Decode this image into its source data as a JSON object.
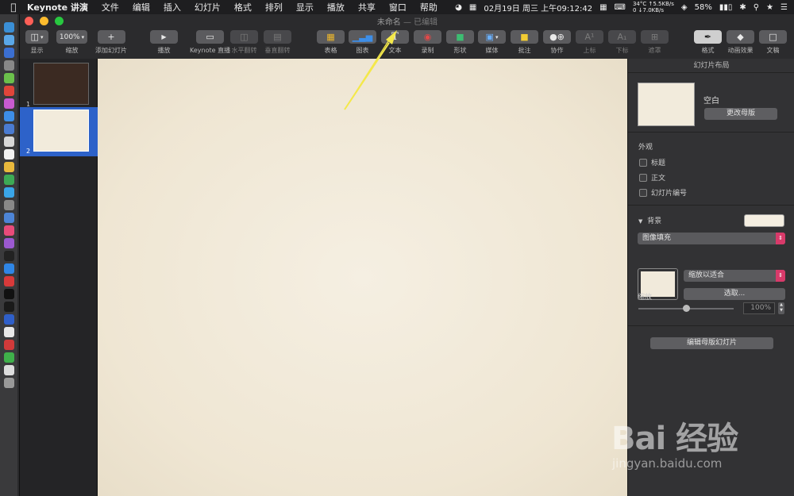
{
  "menubar": {
    "app_name": "Keynote 讲演",
    "items": [
      "文件",
      "编辑",
      "插入",
      "幻灯片",
      "格式",
      "排列",
      "显示",
      "播放",
      "共享",
      "窗口",
      "帮助"
    ],
    "datetime": "02月19日 周三 上午09:12:42",
    "temperature": "34°C",
    "net_up": "↑5.5KB/s",
    "net_down": "↓7.0KB/s",
    "net_count": "0",
    "battery": "58%"
  },
  "window": {
    "title": "未命名",
    "title_suffix": "— 已编辑"
  },
  "toolbar": {
    "view_label": "显示",
    "zoom_value": "100%",
    "zoom_label": "缩放",
    "add_slide_label": "添加幻灯片",
    "play_label": "播放",
    "keynote_live_label": "Keynote 直播",
    "flip_h_label": "水平翻转",
    "flip_v_label": "垂直翻转",
    "table_label": "表格",
    "chart_label": "图表",
    "text_label": "文本",
    "record_label": "录制",
    "shape_label": "形状",
    "media_label": "媒体",
    "comment_label": "批注",
    "collab_label": "协作",
    "superscript_label": "上标",
    "subscript_label": "下标",
    "mask_label": "遮罩",
    "format_label": "格式",
    "animate_label": "动画效果",
    "document_label": "文稿"
  },
  "navigator": {
    "slides": [
      {
        "number": "1",
        "thumb_color": "#3b2a22"
      },
      {
        "number": "2",
        "thumb_color": "#f2ebdc"
      }
    ]
  },
  "inspector": {
    "title": "幻灯片布局",
    "master_name": "空白",
    "change_master_label": "更改母版",
    "appearance_label": "外观",
    "checkbox_title": "标题",
    "checkbox_body": "正文",
    "checkbox_slide_number": "幻灯片编号",
    "background_label": "背景",
    "fill_type": "图像填充",
    "scale_mode": "缩放以适合",
    "choose_label": "选取...",
    "scale_label": "缩放",
    "scale_value": "100%",
    "scale_fraction": 0.5,
    "edit_master_label": "编辑母版幻灯片"
  },
  "watermark": {
    "brand": "Bai 经验",
    "url": "jingyan.baidu.com"
  },
  "colors": {
    "accent": "#2d62c9",
    "popup_arrow": "#d83a6a",
    "annotation": "#f4e84a"
  }
}
